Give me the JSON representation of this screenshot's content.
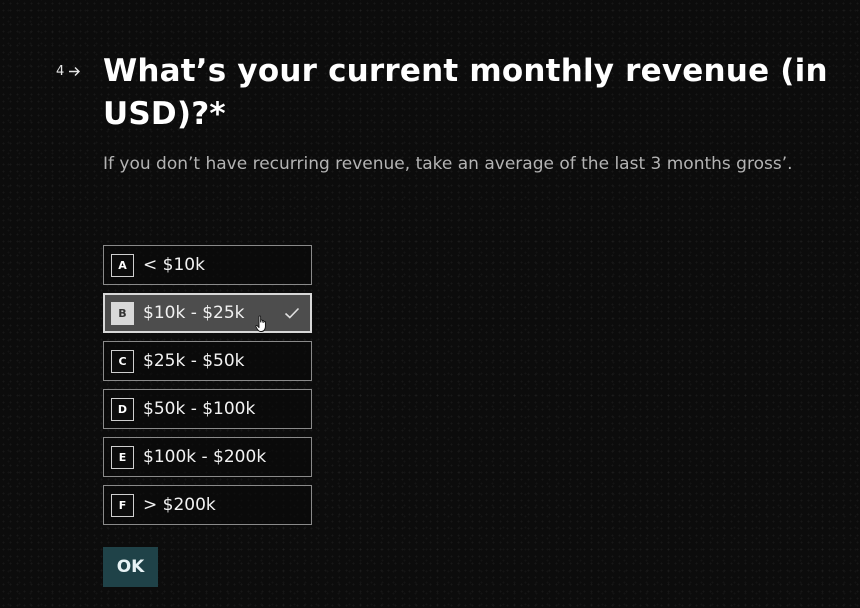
{
  "question": {
    "number": "4",
    "title": "What’s your current monthly revenue (in USD)?*",
    "subtitle": "If you don’t have recurring revenue, take an average of the last 3 months gross’."
  },
  "options": [
    {
      "key": "A",
      "label": "< $10k",
      "selected": false
    },
    {
      "key": "B",
      "label": "$10k - $25k",
      "selected": true
    },
    {
      "key": "C",
      "label": "$25k - $50k",
      "selected": false
    },
    {
      "key": "D",
      "label": "$50k - $100k",
      "selected": false
    },
    {
      "key": "E",
      "label": "$100k - $200k",
      "selected": false
    },
    {
      "key": "F",
      "label": "> $200k",
      "selected": false
    }
  ],
  "ok_button": {
    "label": "OK"
  },
  "icons": {
    "question_arrow": "arrow-right-icon",
    "selected_mark": "checkmark-icon",
    "pointer": "hand-cursor-icon"
  },
  "colors": {
    "background": "#0c0c0c",
    "text": "#ffffff",
    "subtitle": "#b3b3b3",
    "option_border": "#8a8a8a",
    "option_selected_bg": "#4d4d4d",
    "ok_button_bg": "#1f4248"
  }
}
